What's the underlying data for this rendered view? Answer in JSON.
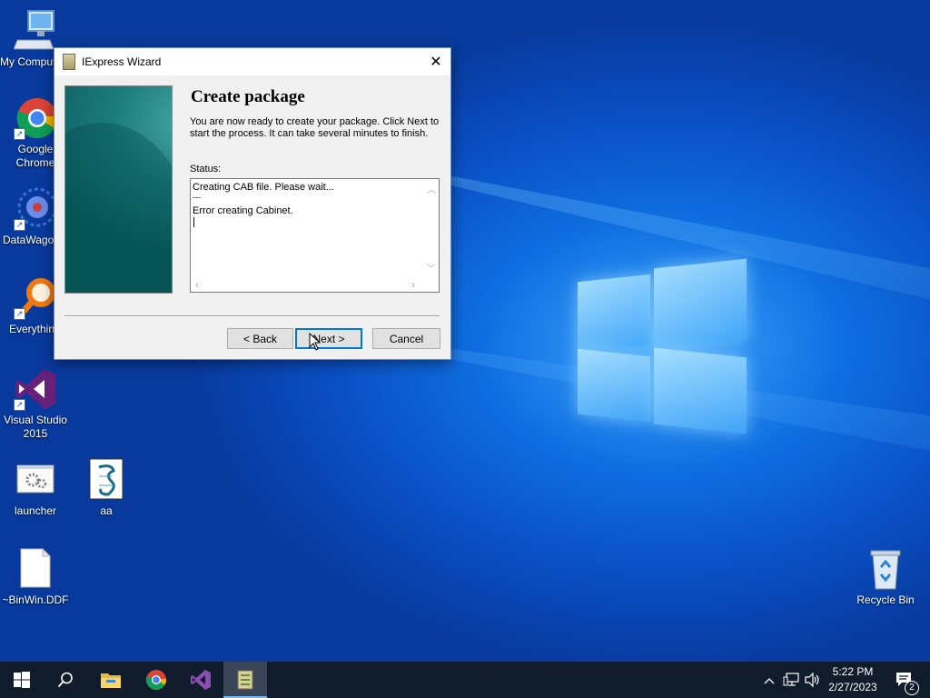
{
  "desktop": {
    "icons": [
      {
        "label": "My Computer"
      },
      {
        "label": "Google Chrome"
      },
      {
        "label": "DataWagon"
      },
      {
        "label": "Everything"
      },
      {
        "label": "Visual Studio 2015"
      },
      {
        "label": "launcher"
      },
      {
        "label": "aa"
      },
      {
        "label": "~BinWin.DDF"
      },
      {
        "label": "Recycle Bin"
      }
    ]
  },
  "dialog": {
    "title": "IExpress Wizard",
    "close_glyph": "✕",
    "heading": "Create package",
    "description": "You are now ready to create your package.  Click Next to start the process.  It can take several minutes to finish.",
    "status_label": "Status:",
    "status_lines": [
      "Creating CAB file.  Please wait...",
      "---",
      "Error creating Cabinet."
    ],
    "buttons": {
      "back": "< Back",
      "next": "Next >",
      "cancel": "Cancel"
    }
  },
  "taskbar": {
    "time": "5:22 PM",
    "date": "2/27/2023",
    "notification_count": "2"
  },
  "colors": {
    "desktop_blue": "#0a4fc4",
    "taskbar": "#101b2b",
    "default_button_border": "#0078d7"
  }
}
